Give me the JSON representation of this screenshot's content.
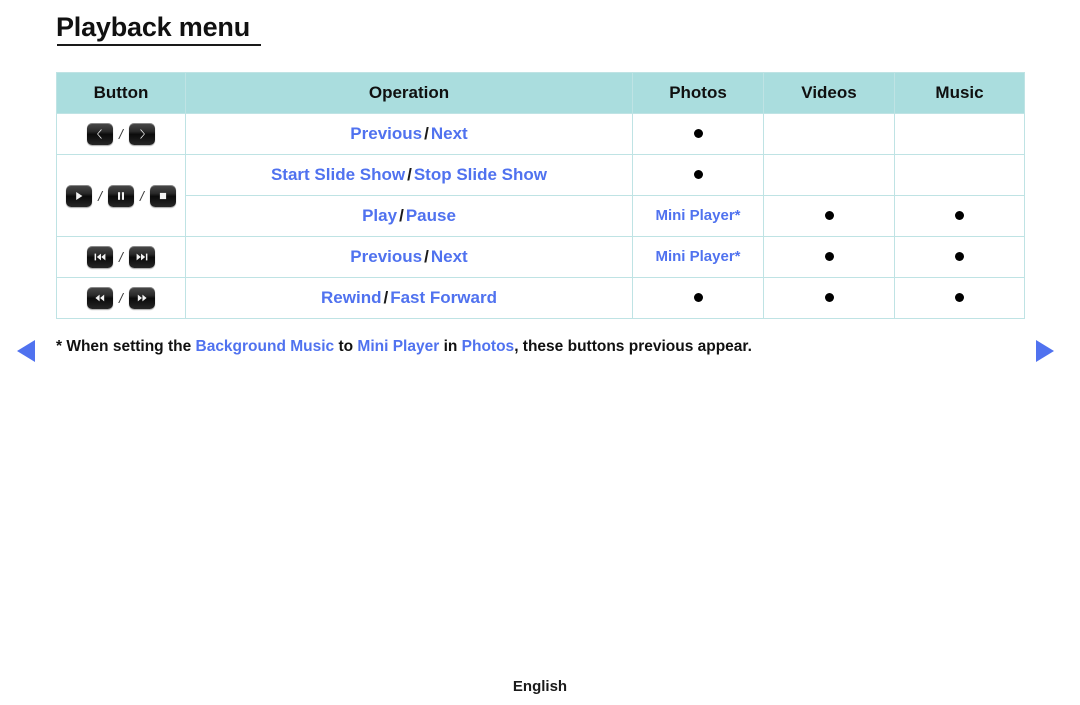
{
  "page": {
    "title": "Playback menu",
    "footer_language": "English"
  },
  "table": {
    "headers": [
      {
        "label": "Button"
      },
      {
        "label": "Operation"
      },
      {
        "label": "Photos"
      },
      {
        "label": "Videos"
      },
      {
        "label": "Music"
      }
    ],
    "rows": [
      {
        "buttons": [
          {
            "icon": "chevron-left-icon"
          },
          {
            "icon": "chevron-right-icon"
          }
        ],
        "operation": {
          "first": "Previous",
          "separator": "/",
          "second": "Next"
        },
        "photos": "●",
        "videos": "",
        "music": ""
      },
      {
        "buttons": [
          {
            "icon": "play-icon"
          },
          {
            "icon": "pause-icon"
          },
          {
            "icon": "stop-icon"
          }
        ],
        "operation": {
          "first": "Start Slide Show",
          "separator": "/",
          "second": "Stop Slide Show"
        },
        "photos": "●",
        "videos": "",
        "music": ""
      },
      {
        "buttons": [],
        "operation": {
          "first": "Play",
          "separator": "/",
          "second": "Pause"
        },
        "photos": "Mini Player*",
        "videos": "●",
        "music": "●"
      },
      {
        "buttons": [
          {
            "icon": "skip-previous-icon"
          },
          {
            "icon": "skip-next-icon"
          }
        ],
        "operation": {
          "first": "Previous",
          "separator": "/",
          "second": "Next"
        },
        "photos": "Mini Player*",
        "videos": "●",
        "music": "●"
      },
      {
        "buttons": [
          {
            "icon": "rewind-icon"
          },
          {
            "icon": "fast-forward-icon"
          }
        ],
        "operation": {
          "first": "Rewind",
          "separator": "/",
          "second": "Fast Forward"
        },
        "photos": "●",
        "videos": "●",
        "music": "●"
      }
    ]
  },
  "footnote": {
    "part1": "* When setting the ",
    "link1": "Background Music",
    "part2": " to ",
    "link2": "Mini Player",
    "part3": " in ",
    "link3": "Photos",
    "part4": ", these buttons previous appear."
  },
  "navigation": {
    "prev_label": "previous-page-arrow",
    "next_label": "next-page-arrow"
  },
  "colors": {
    "header_bg": "#aaddde",
    "border": "#bfe3e4",
    "link_blue": "#5072ef",
    "text_black": "#111111"
  }
}
